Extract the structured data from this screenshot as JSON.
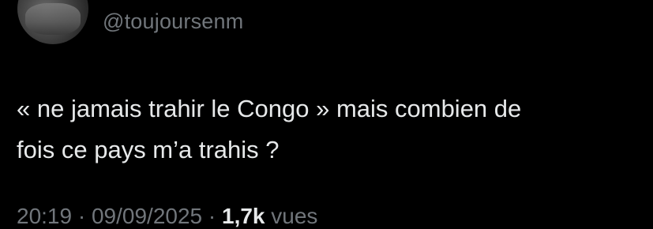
{
  "tweet": {
    "author_handle": "@toujoursenm",
    "text_line1": "« ne jamais trahir le Congo » mais combien de",
    "text_line2": "fois ce pays m’a trahis ?",
    "time": "20:19",
    "date": "09/09/2025",
    "separator": "·",
    "views_count": "1,7k",
    "views_label": "vues"
  }
}
